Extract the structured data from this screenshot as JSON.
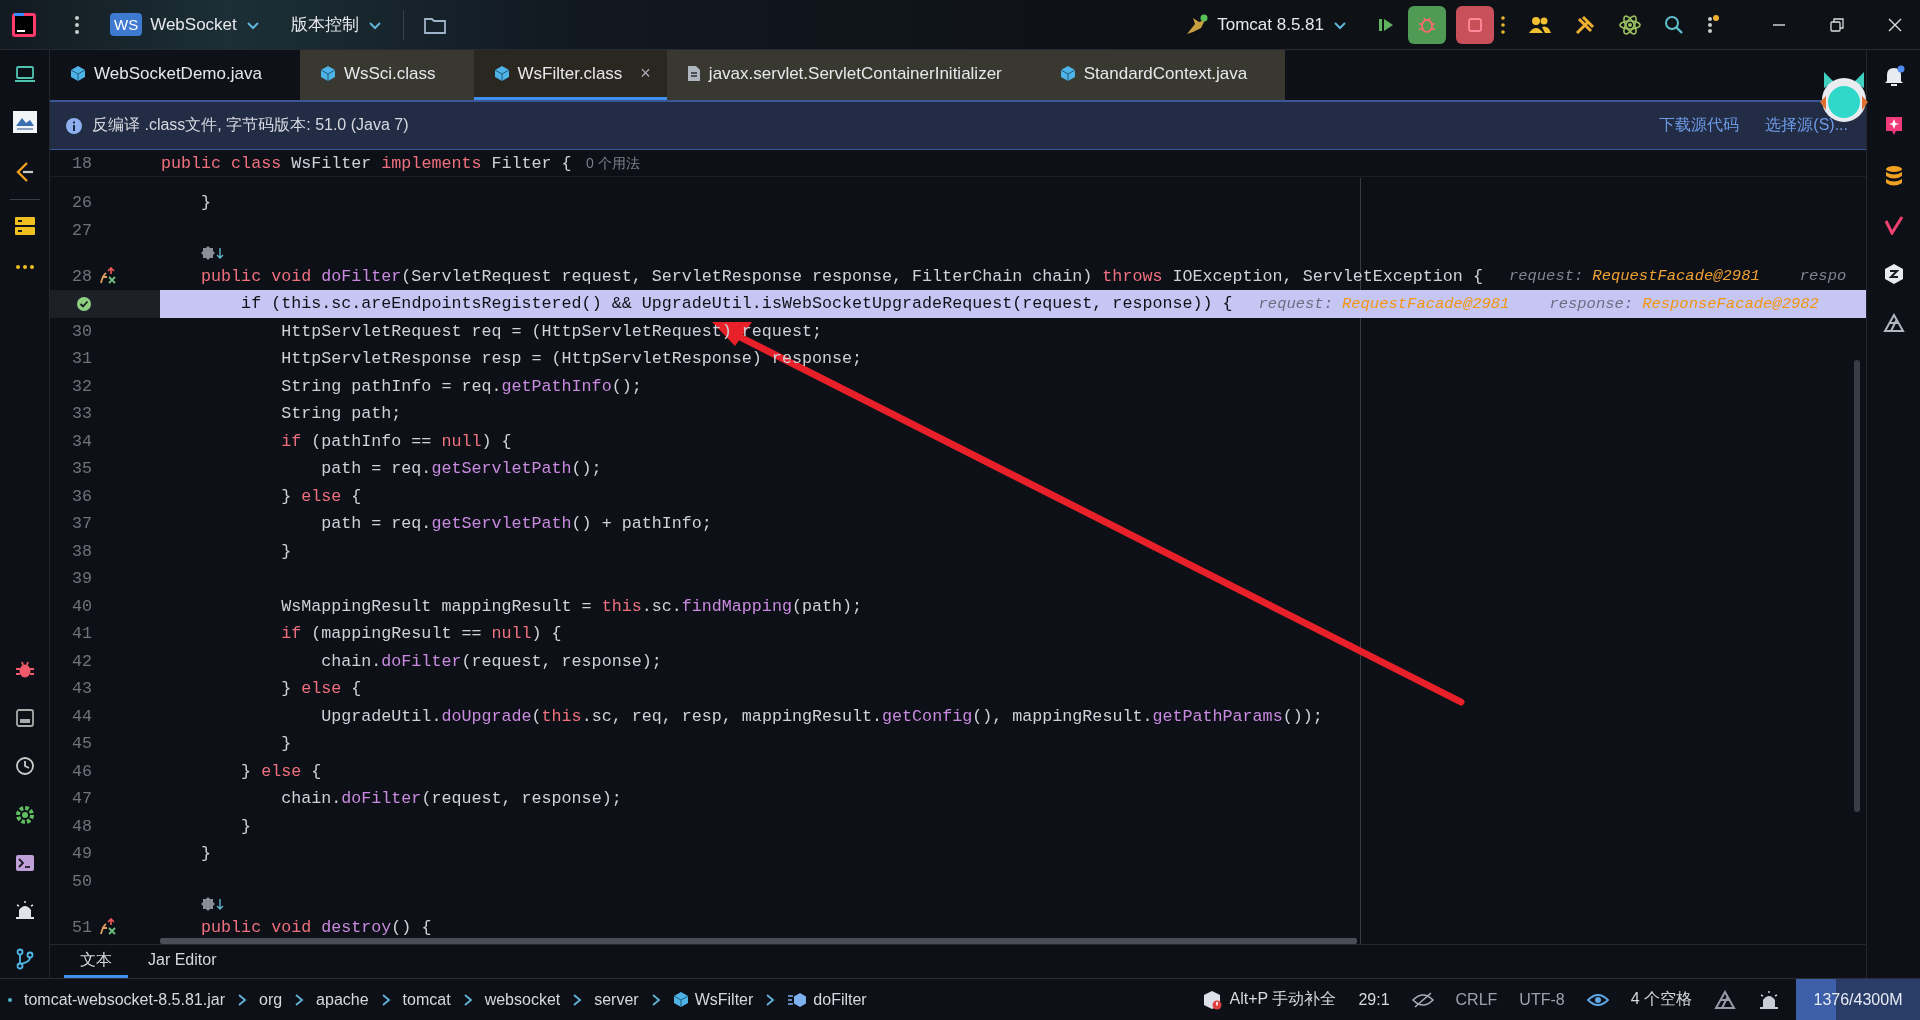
{
  "toolbar": {
    "badge": "WS",
    "project": "WebSocket",
    "vcs": "版本控制",
    "run_config": "Tomcat 8.5.81"
  },
  "tabs": [
    {
      "label": "WebSocketDemo.java",
      "kind": "class",
      "selected": false,
      "color": "#0e1117"
    },
    {
      "label": "WsSci.class",
      "kind": "class",
      "selected": false,
      "color": "#393830"
    },
    {
      "label": "WsFilter.class",
      "kind": "class",
      "selected": true,
      "color": "#2a2620",
      "close": "×"
    },
    {
      "label": "javax.servlet.ServletContainerInitializer",
      "kind": "file",
      "selected": false,
      "color": "#393830"
    },
    {
      "label": "StandardContext.java",
      "kind": "class",
      "selected": false,
      "color": "#393830"
    }
  ],
  "info_bar": {
    "message": "反编译 .class文件, 字节码版本: 51.0 (Java 7)",
    "links": [
      "下载源代码",
      "选择源(S)..."
    ]
  },
  "editor": {
    "sticky": {
      "number": "18",
      "code": [
        {
          "kind": "k",
          "text": "public class "
        },
        {
          "kind": "p",
          "text": "WsFilter "
        },
        {
          "kind": "k",
          "text": "implements "
        },
        {
          "kind": "p",
          "text": "Filter {"
        }
      ],
      "hint": "0 个用法"
    },
    "lines": [
      {
        "kind": "code",
        "number": "26",
        "current": false,
        "overrides": false,
        "code": [
          {
            "kind": "p",
            "text": "    }"
          }
        ]
      },
      {
        "kind": "code",
        "number": "27",
        "current": false,
        "overrides": false
      },
      {
        "kind": "lens"
      },
      {
        "kind": "code",
        "number": "28",
        "current": false,
        "overrides": true,
        "code": [
          {
            "kind": "k",
            "text": "    public void "
          },
          {
            "kind": "m",
            "text": "doFilter"
          },
          {
            "kind": "p",
            "text": "(ServletRequest request, ServletResponse response, FilterChain chain) "
          },
          {
            "kind": "k",
            "text": "throws"
          },
          {
            "kind": "p",
            "text": " IOException, ServletException {"
          },
          {
            "kind": "hn",
            "text": "request:"
          },
          {
            "kind": "hv",
            "text": "RequestFacade@2981"
          },
          {
            "kind": "hn",
            "text": "respo"
          }
        ]
      },
      {
        "kind": "code",
        "current": true,
        "overrides": false,
        "code": [
          {
            "kind": "k",
            "text": "        if"
          },
          {
            "kind": "p",
            "text": " ("
          },
          {
            "kind": "k",
            "text": "this"
          },
          {
            "kind": "p",
            "text": ".sc.areEndpointsRegistered() && UpgradeUtil.isWebSocketUpgradeRequest(request, response)) {"
          },
          {
            "kind": "hn",
            "text": "request:"
          },
          {
            "kind": "hv",
            "text": "RequestFacade@2981"
          },
          {
            "kind": "hn",
            "text": "response:"
          },
          {
            "kind": "hv",
            "text": "ResponseFacade@2982"
          }
        ]
      },
      {
        "kind": "code",
        "number": "30",
        "current": false,
        "overrides": false,
        "code": [
          {
            "kind": "p",
            "text": "            HttpServletRequest req = (HttpServletRequest) request;"
          }
        ]
      },
      {
        "kind": "code",
        "number": "31",
        "current": false,
        "overrides": false,
        "code": [
          {
            "kind": "p",
            "text": "            HttpServletResponse resp = (HttpServletResponse) response;"
          }
        ]
      },
      {
        "kind": "code",
        "number": "32",
        "current": false,
        "overrides": false,
        "code": [
          {
            "kind": "p",
            "text": "            String pathInfo = req."
          },
          {
            "kind": "m",
            "text": "getPathInfo"
          },
          {
            "kind": "p",
            "text": "();"
          }
        ]
      },
      {
        "kind": "code",
        "number": "33",
        "current": false,
        "overrides": false,
        "code": [
          {
            "kind": "p",
            "text": "            String path;"
          }
        ]
      },
      {
        "kind": "code",
        "number": "34",
        "current": false,
        "overrides": false,
        "code": [
          {
            "kind": "k",
            "text": "            if"
          },
          {
            "kind": "p",
            "text": " (pathInfo == "
          },
          {
            "kind": "k",
            "text": "null"
          },
          {
            "kind": "p",
            "text": ") {"
          }
        ]
      },
      {
        "kind": "code",
        "number": "35",
        "current": false,
        "overrides": false,
        "code": [
          {
            "kind": "p",
            "text": "                path = req."
          },
          {
            "kind": "m",
            "text": "getServletPath"
          },
          {
            "kind": "p",
            "text": "();"
          }
        ]
      },
      {
        "kind": "code",
        "number": "36",
        "current": false,
        "overrides": false,
        "code": [
          {
            "kind": "p",
            "text": "            } "
          },
          {
            "kind": "k",
            "text": "else"
          },
          {
            "kind": "p",
            "text": " {"
          }
        ]
      },
      {
        "kind": "code",
        "number": "37",
        "current": false,
        "overrides": false,
        "code": [
          {
            "kind": "p",
            "text": "                path = req."
          },
          {
            "kind": "m",
            "text": "getServletPath"
          },
          {
            "kind": "p",
            "text": "() + pathInfo;"
          }
        ]
      },
      {
        "kind": "code",
        "number": "38",
        "current": false,
        "overrides": false,
        "code": [
          {
            "kind": "p",
            "text": "            }"
          }
        ]
      },
      {
        "kind": "code",
        "number": "39",
        "current": false,
        "overrides": false
      },
      {
        "kind": "code",
        "number": "40",
        "current": false,
        "overrides": false,
        "code": [
          {
            "kind": "p",
            "text": "            WsMappingResult mappingResult = "
          },
          {
            "kind": "k",
            "text": "this"
          },
          {
            "kind": "p",
            "text": ".sc."
          },
          {
            "kind": "m",
            "text": "findMapping"
          },
          {
            "kind": "p",
            "text": "(path);"
          }
        ]
      },
      {
        "kind": "code",
        "number": "41",
        "current": false,
        "overrides": false,
        "code": [
          {
            "kind": "k",
            "text": "            if"
          },
          {
            "kind": "p",
            "text": " (mappingResult == "
          },
          {
            "kind": "k",
            "text": "null"
          },
          {
            "kind": "p",
            "text": ") {"
          }
        ]
      },
      {
        "kind": "code",
        "number": "42",
        "current": false,
        "overrides": false,
        "code": [
          {
            "kind": "p",
            "text": "                chain."
          },
          {
            "kind": "m",
            "text": "doFilter"
          },
          {
            "kind": "p",
            "text": "(request, response);"
          }
        ]
      },
      {
        "kind": "code",
        "number": "43",
        "current": false,
        "overrides": false,
        "code": [
          {
            "kind": "p",
            "text": "            } "
          },
          {
            "kind": "k",
            "text": "else"
          },
          {
            "kind": "p",
            "text": " {"
          }
        ]
      },
      {
        "kind": "code",
        "number": "44",
        "current": false,
        "overrides": false,
        "code": [
          {
            "kind": "p",
            "text": "                UpgradeUtil."
          },
          {
            "kind": "m",
            "text": "doUpgrade"
          },
          {
            "kind": "p",
            "text": "("
          },
          {
            "kind": "k",
            "text": "this"
          },
          {
            "kind": "p",
            "text": ".sc, req, resp, mappingResult."
          },
          {
            "kind": "m",
            "text": "getConfig"
          },
          {
            "kind": "p",
            "text": "(), mappingResult."
          },
          {
            "kind": "m",
            "text": "getPathParams"
          },
          {
            "kind": "p",
            "text": "());"
          }
        ]
      },
      {
        "kind": "code",
        "number": "45",
        "current": false,
        "overrides": false,
        "code": [
          {
            "kind": "p",
            "text": "            }"
          }
        ]
      },
      {
        "kind": "code",
        "number": "46",
        "current": false,
        "overrides": false,
        "code": [
          {
            "kind": "p",
            "text": "        } "
          },
          {
            "kind": "k",
            "text": "else"
          },
          {
            "kind": "p",
            "text": " {"
          }
        ]
      },
      {
        "kind": "code",
        "number": "47",
        "current": false,
        "overrides": false,
        "code": [
          {
            "kind": "p",
            "text": "            chain."
          },
          {
            "kind": "m",
            "text": "doFilter"
          },
          {
            "kind": "p",
            "text": "(request, response);"
          }
        ]
      },
      {
        "kind": "code",
        "number": "48",
        "current": false,
        "overrides": false,
        "code": [
          {
            "kind": "p",
            "text": "        }"
          }
        ]
      },
      {
        "kind": "code",
        "number": "49",
        "current": false,
        "overrides": false,
        "code": [
          {
            "kind": "p",
            "text": "    }"
          }
        ]
      },
      {
        "kind": "code",
        "number": "50",
        "current": false,
        "overrides": false
      },
      {
        "kind": "lens"
      },
      {
        "kind": "code",
        "number": "51",
        "current": false,
        "overrides": true,
        "code": [
          {
            "kind": "k",
            "text": "    public void "
          },
          {
            "kind": "m",
            "text": "destroy"
          },
          {
            "kind": "p",
            "text": "() {"
          }
        ]
      }
    ]
  },
  "bottom_tabs": [
    {
      "label": "文本",
      "selected": true
    },
    {
      "label": "Jar Editor",
      "selected": false
    }
  ],
  "breadcrumbs": [
    {
      "label": "tomcat-websocket-8.5.81.jar",
      "kind": "jar"
    },
    {
      "label": "org",
      "kind": "package"
    },
    {
      "label": "apache",
      "kind": "package"
    },
    {
      "label": "tomcat",
      "kind": "package"
    },
    {
      "label": "websocket",
      "kind": "package"
    },
    {
      "label": "server",
      "kind": "package"
    },
    {
      "label": "WsFilter",
      "kind": "class"
    },
    {
      "label": "doFilter",
      "kind": "method"
    }
  ],
  "status_bar": {
    "completion": "Alt+P 手动补全",
    "position": "29:1",
    "line_separator": "CRLF",
    "encoding": "UTF-8",
    "indent": "4 个空格",
    "memory": {
      "text": "1376/4300M",
      "level": 0.32
    }
  }
}
